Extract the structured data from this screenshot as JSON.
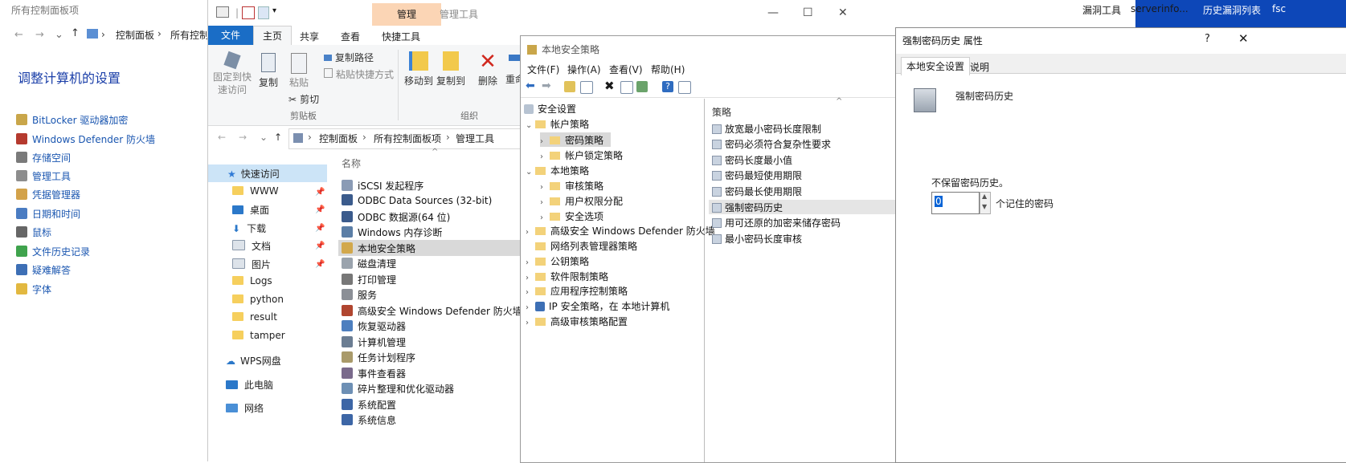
{
  "taskbar": {
    "items": [
      "漏洞工具",
      "serverinfo...",
      "历史漏洞列表",
      "fsc"
    ]
  },
  "control_panel": {
    "title": "所有控制面板项",
    "breadcrumb": [
      "控制面板",
      "所有控制"
    ],
    "heading": "调整计算机的设置",
    "items": [
      "BitLocker 驱动器加密",
      "Windows Defender 防火墙",
      "存储空间",
      "管理工具",
      "凭据管理器",
      "日期和时间",
      "鼠标",
      "文件历史记录",
      "疑难解答",
      "字体"
    ]
  },
  "explorer": {
    "context_tab": "管理",
    "context_title": "管理工具",
    "tabs": [
      "文件",
      "主页",
      "共享",
      "查看",
      "快捷工具"
    ],
    "ribbon": {
      "pin": "固定到快\n速访问",
      "copy": "复制",
      "paste": "粘贴",
      "copy_path": "复制路径",
      "paste_shortcut": "粘贴快捷方式",
      "cut": "剪切",
      "move_to": "移动到",
      "copy_to": "复制到",
      "delete": "删除",
      "rename": "重命",
      "group_clipboard": "剪贴板",
      "group_organize": "组织"
    },
    "breadcrumb": [
      "控制面板",
      "所有控制面板项",
      "管理工具"
    ],
    "nav": {
      "quick_access": "快速访问",
      "items": [
        "WWW",
        "桌面",
        "下载",
        "文档",
        "图片",
        "Logs",
        "python",
        "result",
        "tamper"
      ],
      "wps": "WPS网盘",
      "pc": "此电脑",
      "network": "网络"
    },
    "column_name": "名称",
    "files": [
      "iSCSI 发起程序",
      "ODBC Data Sources (32-bit)",
      "ODBC 数据源(64 位)",
      "Windows 内存诊断",
      "本地安全策略",
      "磁盘清理",
      "打印管理",
      "服务",
      "高级安全 Windows Defender 防火墙",
      "恢复驱动器",
      "计算机管理",
      "任务计划程序",
      "事件查看器",
      "碎片整理和优化驱动器",
      "系统配置",
      "系统信息"
    ]
  },
  "lsp": {
    "title": "本地安全策略",
    "menu": [
      "文件(F)",
      "操作(A)",
      "查看(V)",
      "帮助(H)"
    ],
    "tree": {
      "root": "安全设置",
      "account_policy": "帐户策略",
      "password_policy": "密码策略",
      "lockout_policy": "帐户锁定策略",
      "local_policy": "本地策略",
      "audit_policy": "审核策略",
      "user_rights": "用户权限分配",
      "security_options": "安全选项",
      "others": [
        "高级安全 Windows Defender 防火墙",
        "网络列表管理器策略",
        "公钥策略",
        "软件限制策略",
        "应用程序控制策略",
        "IP 安全策略，在 本地计算机",
        "高级审核策略配置"
      ]
    },
    "policy_header": "策略",
    "policies": [
      "放宽最小密码长度限制",
      "密码必须符合复杂性要求",
      "密码长度最小值",
      "密码最短使用期限",
      "密码最长使用期限",
      "强制密码历史",
      "用可还原的加密来储存密码",
      "最小密码长度审核"
    ]
  },
  "dialog": {
    "title": "强制密码历史 属性",
    "help": "?",
    "close": "✕",
    "tabs": [
      "本地安全设置",
      "说明"
    ],
    "policy_name": "强制密码历史",
    "description": "不保留密码历史。",
    "value": "0",
    "unit_label": "个记住的密码"
  }
}
